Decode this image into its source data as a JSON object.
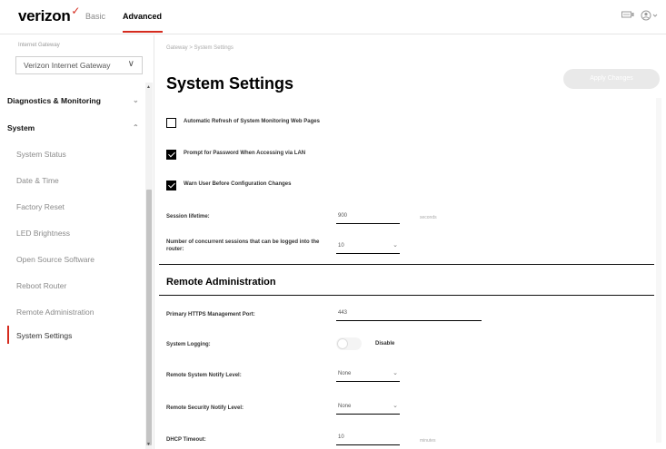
{
  "header": {
    "logo": "verizon",
    "logo_check": "✓",
    "tabs": [
      "Basic",
      "Advanced"
    ],
    "devices_icon": "devices-icon",
    "user_icon": "user-icon"
  },
  "sidebar": {
    "gateway_label": "Internet Gateway",
    "gateway_value": "Verizon Internet Gateway",
    "sections": [
      "Diagnostics & Monitoring",
      "System"
    ],
    "items": [
      "System Status",
      "Date & Time",
      "Factory Reset",
      "LED Brightness",
      "Open Source Software",
      "Reboot Router",
      "Remote Administration",
      "System Settings"
    ]
  },
  "main": {
    "breadcrumb": "Gateway > System Settings",
    "title": "System Settings",
    "apply_label": "Apply Changes",
    "checkboxes": [
      {
        "label": "Automatic Refresh of System Monitoring Web Pages",
        "checked": false
      },
      {
        "label": "Prompt for Password When Accessing via LAN",
        "checked": true
      },
      {
        "label": "Warn User Before Configuration Changes",
        "checked": true
      }
    ],
    "session_lifetime": {
      "label": "Session lifetime:",
      "value": "900",
      "unit": "seconds"
    },
    "concurrent_sessions": {
      "label": "Number of concurrent sessions that can be logged into the router:",
      "value": "10"
    },
    "remote_admin_title": "Remote Administration",
    "https_port": {
      "label": "Primary HTTPS Management Port:",
      "value": "443"
    },
    "system_logging": {
      "label": "System Logging:",
      "state": "Disable"
    },
    "remote_system_notify": {
      "label": "Remote System Notify Level:",
      "value": "None"
    },
    "remote_security_notify": {
      "label": "Remote Security Notify Level:",
      "value": "None"
    },
    "dhcp_timeout": {
      "label": "DHCP Timeout:",
      "value": "10",
      "unit": "minutes"
    }
  },
  "colors": {
    "accent": "#d52b1e",
    "text": "#000000",
    "muted": "#8a8a8a"
  }
}
